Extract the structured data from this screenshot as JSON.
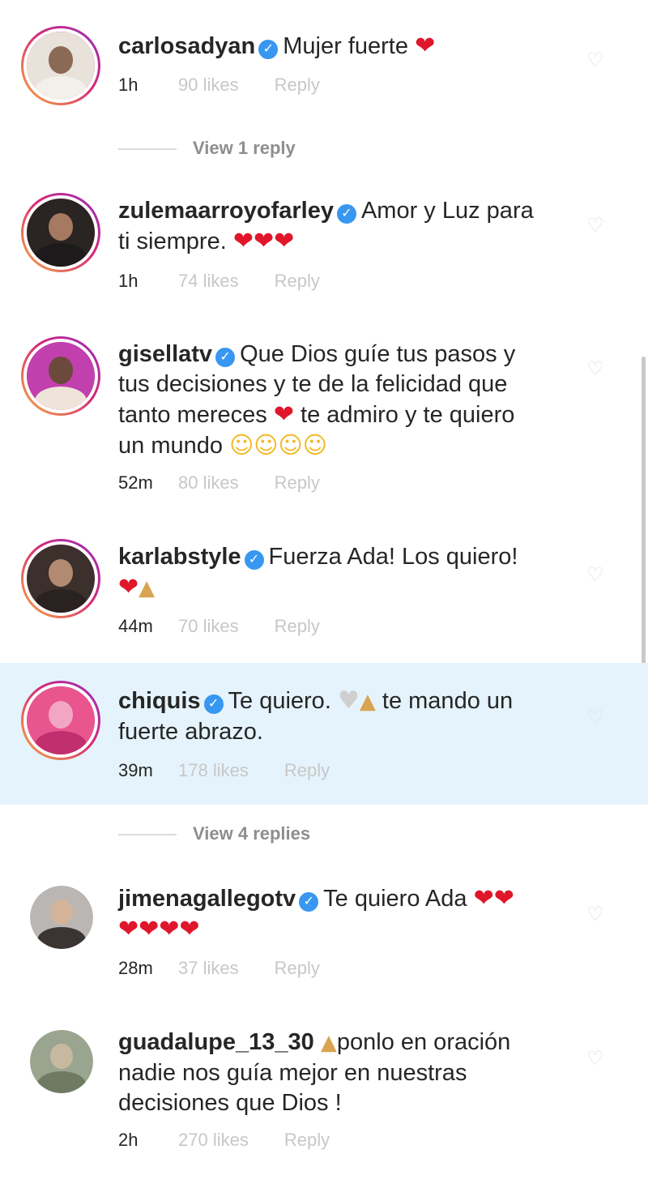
{
  "comments": [
    {
      "username": "carlosadyan",
      "verified": true,
      "text": "Mujer fuerte",
      "time": "1h",
      "likes": "90 likes",
      "reply": "Reply",
      "view_replies": "View 1 reply"
    },
    {
      "username": "zulemaarroyofarley",
      "verified": true,
      "text": "Amor y Luz para",
      "text2": "ti siempre.",
      "time": "1h",
      "likes": "74 likes",
      "reply": "Reply"
    },
    {
      "username": "gisellatv",
      "verified": true,
      "text": "Que Dios guíe tus pasos y",
      "text2": "tus decisiones y te de la felicidad que",
      "text3": "tanto mereces",
      "text4": "te admiro y te quiero",
      "text5": "un mundo",
      "time": "52m",
      "likes": "80 likes",
      "reply": "Reply"
    },
    {
      "username": "karlabstyle",
      "verified": true,
      "text": "Fuerza Ada! Los quiero!",
      "time": "44m",
      "likes": "70 likes",
      "reply": "Reply"
    },
    {
      "username": "chiquis",
      "verified": true,
      "text": "Te quiero.",
      "text2": "te mando un",
      "text3": "fuerte abrazo.",
      "time": "39m",
      "likes": "178 likes",
      "reply": "Reply",
      "view_replies": "View 4 replies"
    },
    {
      "username": "jimenagallegotv",
      "verified": true,
      "text": "Te quiero Ada",
      "time": "28m",
      "likes": "37 likes",
      "reply": "Reply"
    },
    {
      "username": "guadalupe_13_30",
      "verified": false,
      "text": "ponlo en oración",
      "text2": "nadie nos guía mejor en nuestras",
      "text3": "decisiones que Dios !",
      "time": "2h",
      "likes": "270 likes",
      "reply": "Reply"
    }
  ],
  "icons": {
    "verified": "verified-badge-icon",
    "like": "heart-outline-icon",
    "emoji_heart": "❤",
    "emoji_white_heart": "♥",
    "emoji_pray": "🙏",
    "emoji_smile": "🥰"
  },
  "colors": {
    "verified": "#3897f0",
    "highlight": "#e5f3fc",
    "heart": "#e0162b",
    "meta": "#8e8e8e"
  }
}
